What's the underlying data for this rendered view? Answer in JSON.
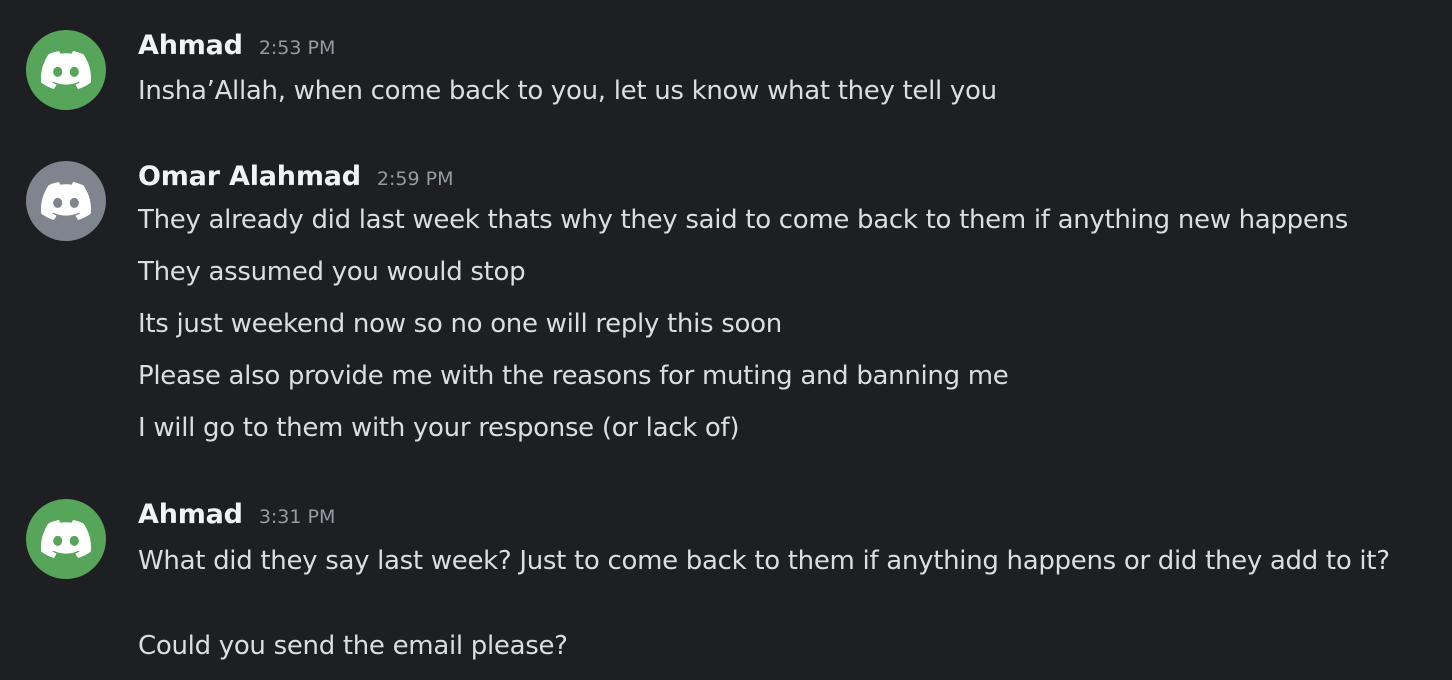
{
  "colors": {
    "background": "#1e1f22",
    "avatar_green": "#57a55a",
    "avatar_gray": "#80848e",
    "username": "#f2f3f5",
    "timestamp": "#949ba4",
    "message_text": "#dbdee1"
  },
  "messages": [
    {
      "username": "Ahmad",
      "timestamp": "2:53 PM",
      "avatar_icon": "discord-logo-icon",
      "avatar_color": "#57a55a",
      "lines": [
        "Insha’Allah, when come back to you, let us know what they tell you"
      ]
    },
    {
      "username": "Omar Alahmad",
      "timestamp": "2:59 PM",
      "avatar_icon": "discord-logo-icon",
      "avatar_color": "#80848e",
      "lines": [
        "They already did last week thats why they said to come back to them if anything new happens",
        "They assumed you would stop",
        "Its just weekend now so no one will reply this soon",
        "Please also provide me with the reasons for muting and banning me",
        "I will go to them with your response (or lack of)"
      ]
    },
    {
      "username": "Ahmad",
      "timestamp": "3:31 PM",
      "avatar_icon": "discord-logo-icon",
      "avatar_color": "#57a55a",
      "lines": [
        "What did they say last week? Just to come back to them if anything happens or did they add to it?",
        "Could you send the email please?"
      ]
    }
  ]
}
